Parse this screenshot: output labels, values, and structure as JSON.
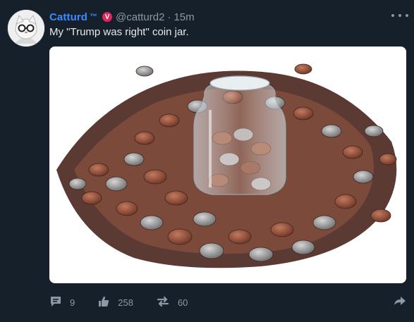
{
  "user": {
    "name": "Catturd",
    "tm": "™",
    "verified_badge": "V",
    "handle": "@catturd2",
    "time": "15m"
  },
  "post": {
    "text": "My \"Trump was right\" coin jar."
  },
  "actions": {
    "comments": "9",
    "likes": "258",
    "reposts": "60"
  },
  "icons": {
    "comment": "comment-icon",
    "like": "thumbs-up-icon",
    "repost": "repost-icon",
    "share": "share-arrow-icon",
    "more": "more-options-icon"
  },
  "colors": {
    "background": "#15202b",
    "name": "#3b8bff",
    "muted": "#8b98a5",
    "badge": "#e0245e"
  }
}
